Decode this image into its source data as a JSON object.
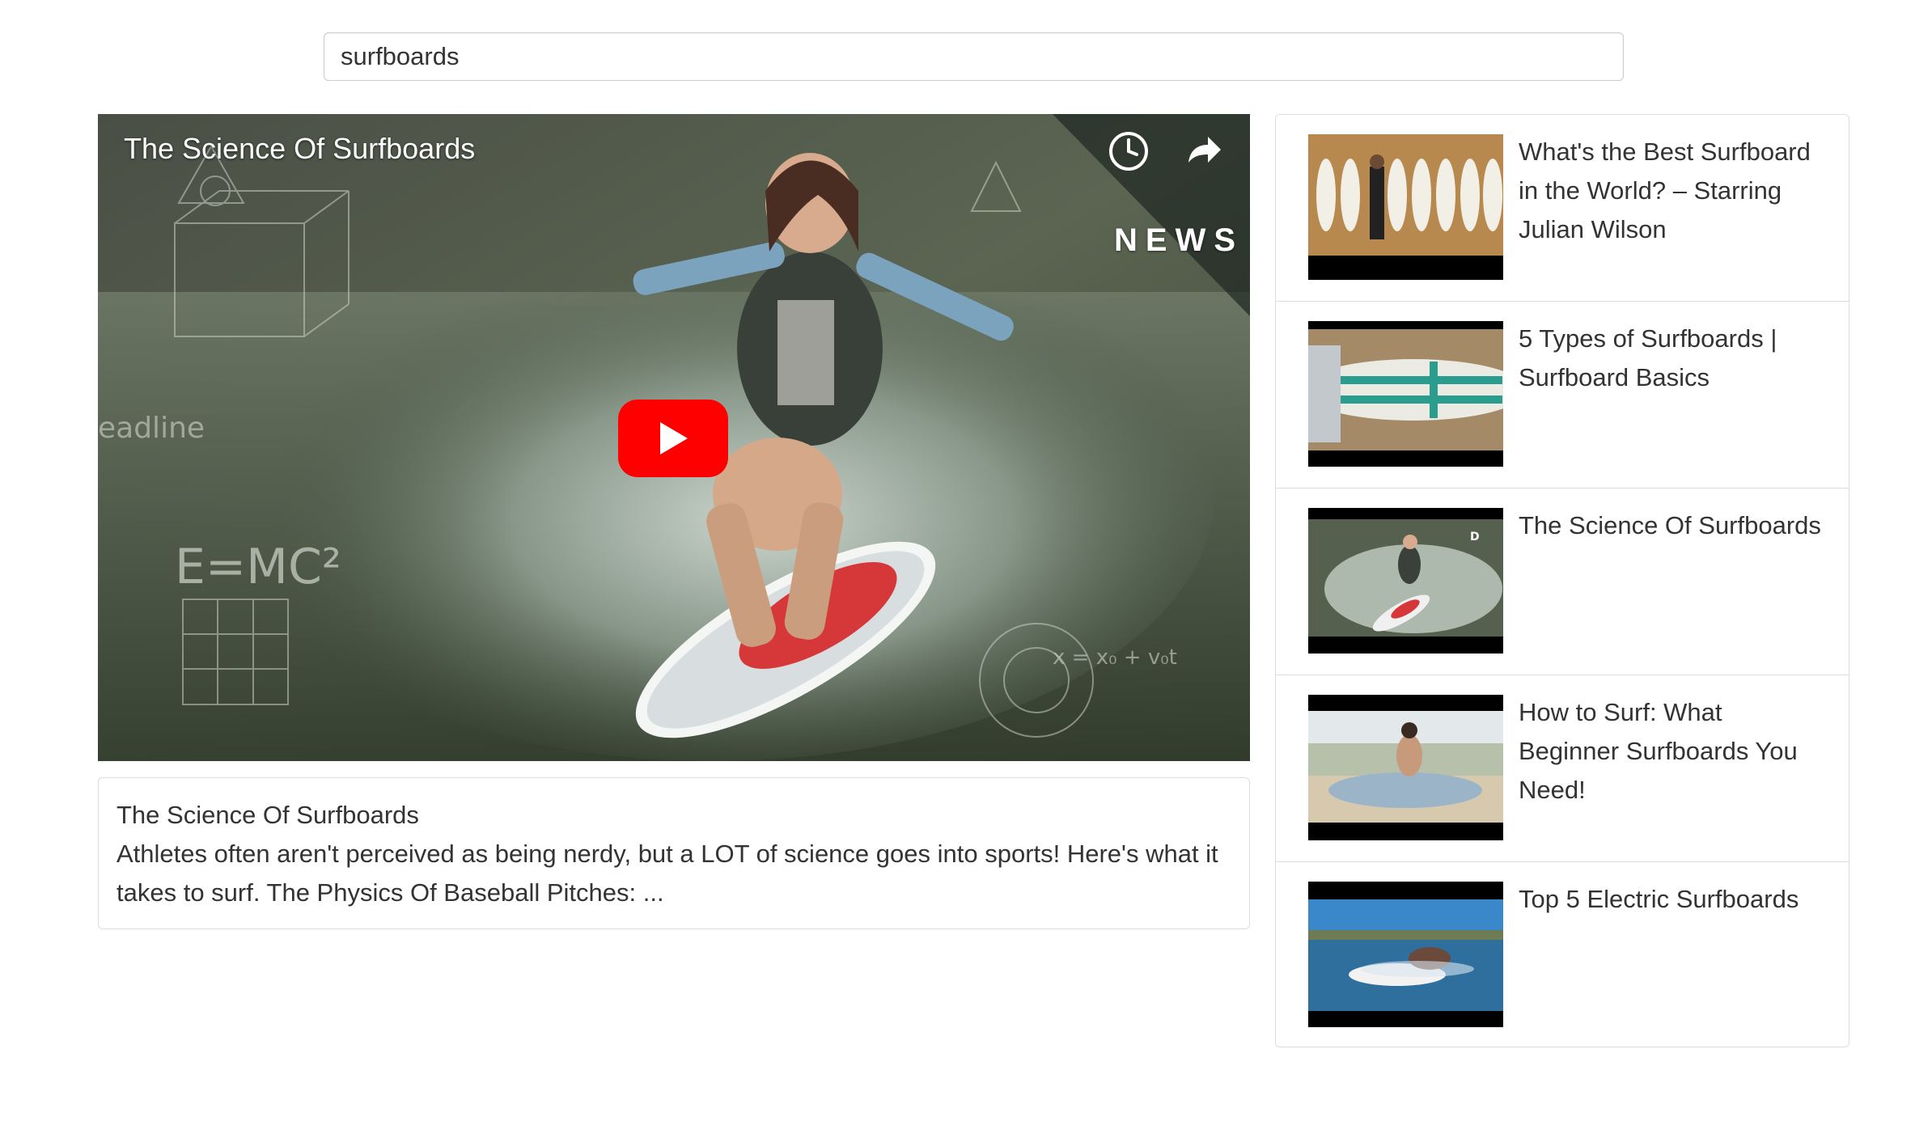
{
  "search": {
    "value": "surfboards"
  },
  "player": {
    "title": "The Science Of Surfboards",
    "channel_logo_text": "NEWS",
    "icons": [
      "clock-icon",
      "share-icon",
      "play-icon"
    ],
    "play_button_color": "#ff0000"
  },
  "description": {
    "title": "The Science Of Surfboards",
    "text": "Athletes often aren't perceived as being nerdy, but a LOT of science goes into sports! Here's what it takes to surf. The Physics Of Baseball Pitches: ..."
  },
  "videos": [
    {
      "title": "What's the Best Surfboard in the World? – Starring Julian Wilson"
    },
    {
      "title": "5 Types of Surfboards | Surfboard Basics"
    },
    {
      "title": "The Science Of Surfboards"
    },
    {
      "title": "How to Surf: What Beginner Surfboards You Need!"
    },
    {
      "title": "Top 5 Electric Surfboards"
    }
  ],
  "colors": {
    "border": "#dddddd",
    "text": "#333333",
    "youtube_red": "#ff0000"
  }
}
